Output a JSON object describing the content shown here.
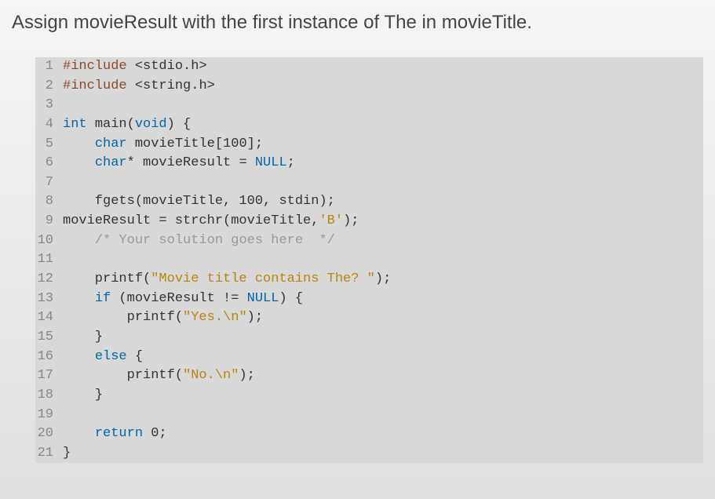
{
  "instruction": "Assign movieResult with the first instance of The in movieTitle.",
  "code": {
    "lines": [
      {
        "num": "1",
        "tokens": [
          {
            "t": "#include",
            "c": "kw-preproc"
          },
          {
            "t": " ",
            "c": ""
          },
          {
            "t": "<stdio.h>",
            "c": "kw-header"
          }
        ]
      },
      {
        "num": "2",
        "tokens": [
          {
            "t": "#include",
            "c": "kw-preproc"
          },
          {
            "t": " ",
            "c": ""
          },
          {
            "t": "<string.h>",
            "c": "kw-header"
          }
        ]
      },
      {
        "num": "3",
        "tokens": []
      },
      {
        "num": "4",
        "tokens": [
          {
            "t": "int",
            "c": "kw-type"
          },
          {
            "t": " ",
            "c": ""
          },
          {
            "t": "main",
            "c": "kw-func"
          },
          {
            "t": "(",
            "c": ""
          },
          {
            "t": "void",
            "c": "kw-type"
          },
          {
            "t": ") {",
            "c": ""
          }
        ]
      },
      {
        "num": "5",
        "tokens": [
          {
            "t": "    ",
            "c": ""
          },
          {
            "t": "char",
            "c": "kw-type"
          },
          {
            "t": " movieTitle[100];",
            "c": ""
          }
        ]
      },
      {
        "num": "6",
        "tokens": [
          {
            "t": "    ",
            "c": ""
          },
          {
            "t": "char",
            "c": "kw-type"
          },
          {
            "t": "* movieResult = ",
            "c": ""
          },
          {
            "t": "NULL",
            "c": "kw-null"
          },
          {
            "t": ";",
            "c": ""
          }
        ]
      },
      {
        "num": "7",
        "tokens": []
      },
      {
        "num": "8",
        "tokens": [
          {
            "t": "    fgets(movieTitle, 100, stdin);",
            "c": ""
          }
        ]
      },
      {
        "num": "9",
        "tokens": [
          {
            "t": "movieResult = strchr(movieTitle,",
            "c": ""
          },
          {
            "t": "'B'",
            "c": "kw-char"
          },
          {
            "t": ");",
            "c": ""
          }
        ]
      },
      {
        "num": "10",
        "tokens": [
          {
            "t": "    ",
            "c": ""
          },
          {
            "t": "/* Your solution goes here  */",
            "c": "kw-comment"
          }
        ]
      },
      {
        "num": "11",
        "tokens": []
      },
      {
        "num": "12",
        "tokens": [
          {
            "t": "    printf(",
            "c": ""
          },
          {
            "t": "\"Movie title contains The? \"",
            "c": "kw-string"
          },
          {
            "t": ");",
            "c": ""
          }
        ]
      },
      {
        "num": "13",
        "tokens": [
          {
            "t": "    ",
            "c": ""
          },
          {
            "t": "if",
            "c": "kw-control"
          },
          {
            "t": " (movieResult != ",
            "c": ""
          },
          {
            "t": "NULL",
            "c": "kw-null"
          },
          {
            "t": ") {",
            "c": ""
          }
        ]
      },
      {
        "num": "14",
        "tokens": [
          {
            "t": "        printf(",
            "c": ""
          },
          {
            "t": "\"Yes.\\n\"",
            "c": "kw-string"
          },
          {
            "t": ");",
            "c": ""
          }
        ]
      },
      {
        "num": "15",
        "tokens": [
          {
            "t": "    }",
            "c": ""
          }
        ]
      },
      {
        "num": "16",
        "tokens": [
          {
            "t": "    ",
            "c": ""
          },
          {
            "t": "else",
            "c": "kw-control"
          },
          {
            "t": " {",
            "c": ""
          }
        ]
      },
      {
        "num": "17",
        "tokens": [
          {
            "t": "        printf(",
            "c": ""
          },
          {
            "t": "\"No.\\n\"",
            "c": "kw-string"
          },
          {
            "t": ");",
            "c": ""
          }
        ]
      },
      {
        "num": "18",
        "tokens": [
          {
            "t": "    }",
            "c": ""
          }
        ]
      },
      {
        "num": "19",
        "tokens": []
      },
      {
        "num": "20",
        "tokens": [
          {
            "t": "    ",
            "c": ""
          },
          {
            "t": "return",
            "c": "kw-control"
          },
          {
            "t": " 0;",
            "c": ""
          }
        ]
      },
      {
        "num": "21",
        "tokens": [
          {
            "t": "}",
            "c": ""
          }
        ]
      }
    ]
  }
}
